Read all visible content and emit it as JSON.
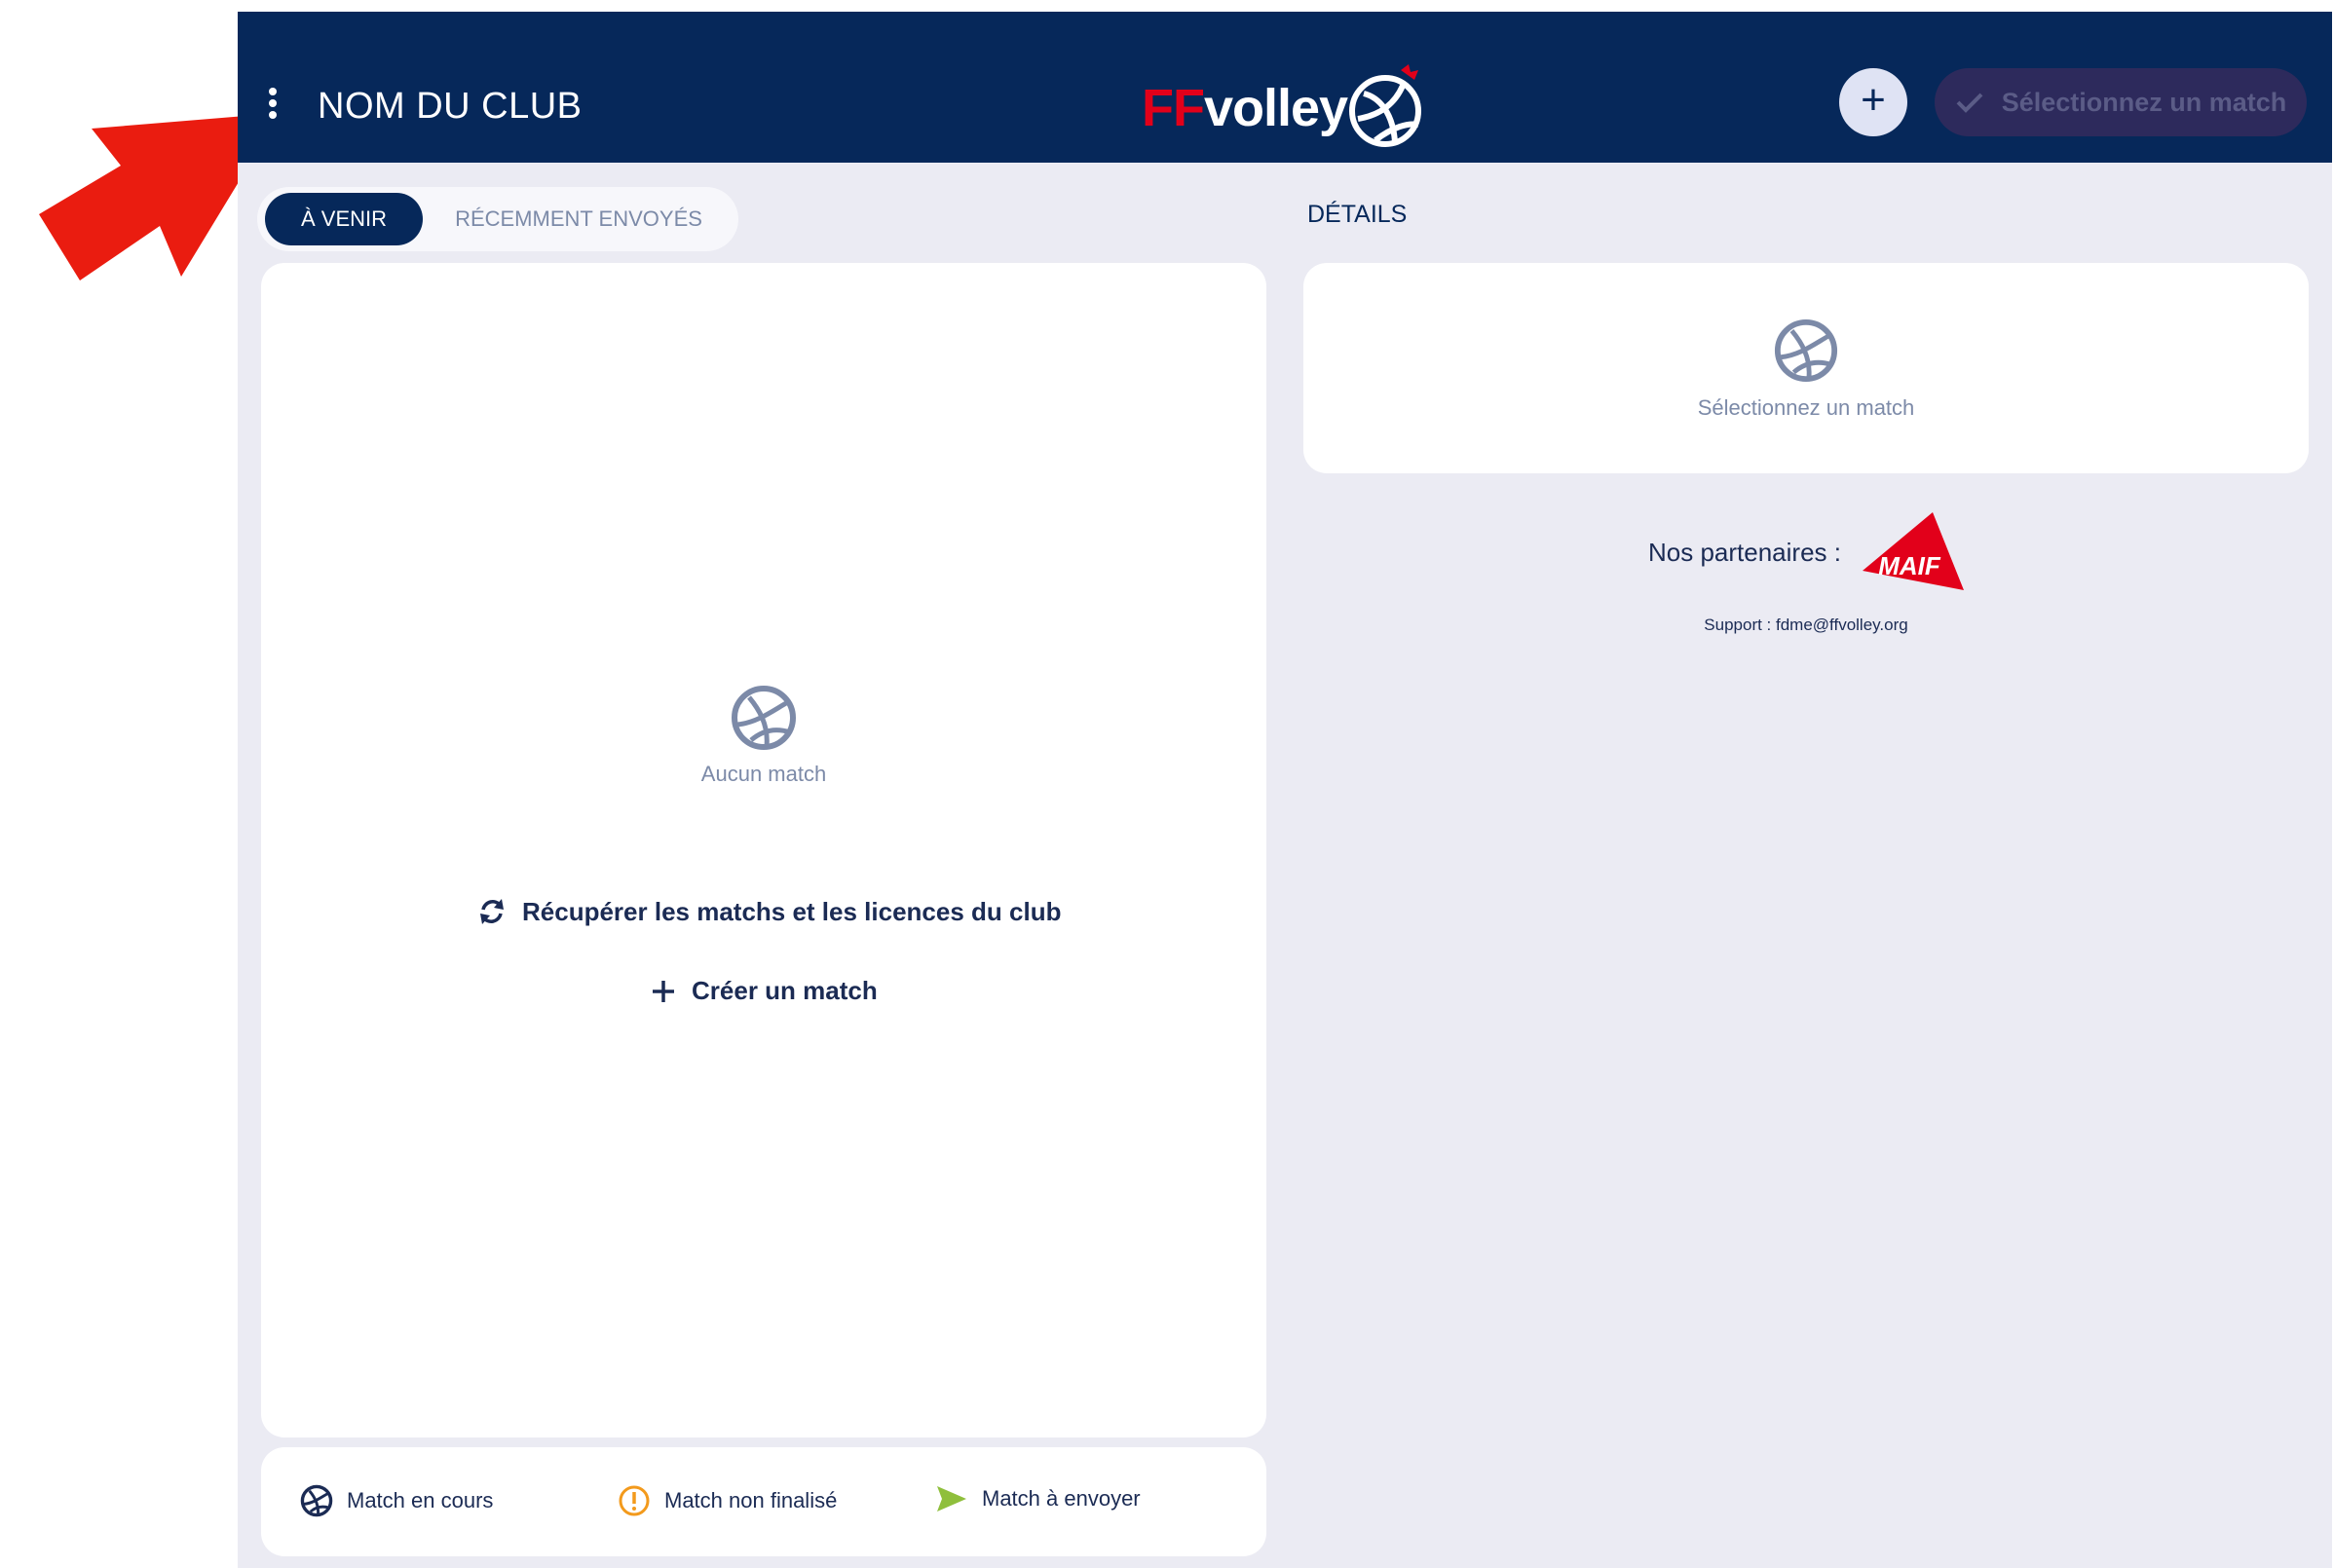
{
  "header": {
    "club_name": "NOM DU CLUB",
    "logo_ff": "FF",
    "logo_volley": "volley",
    "add_label": "+",
    "select_match_label": "Sélectionnez un match",
    "menu_icon": "vertical-dots-icon"
  },
  "tabs": [
    {
      "label": "À VENIR",
      "active": true
    },
    {
      "label": "RÉCEMMENT ENVOYÉS",
      "active": false
    }
  ],
  "details": {
    "label": "DÉTAILS",
    "empty_text": "Sélectionnez un match"
  },
  "matches": {
    "empty_text": "Aucun match",
    "fetch_label": "Récupérer les matchs et les licences du club",
    "create_label": "Créer un match"
  },
  "legend": [
    {
      "label": "Match en cours",
      "icon": "volleyball-icon"
    },
    {
      "label": "Match non finalisé",
      "icon": "warning-circle-icon"
    },
    {
      "label": "Match à envoyer",
      "icon": "send-icon"
    }
  ],
  "partners": {
    "label": "Nos partenaires :",
    "logo_text": "MAIF"
  },
  "support": {
    "text": "Support : fdme@ffvolley.org"
  },
  "colors": {
    "header_bg": "#06285a",
    "brand_red": "#e2001a",
    "page_bg": "#ebebf3",
    "muted": "#7c8aa8",
    "arrow": "#ea1c10",
    "send_green": "#8fbf3c",
    "warning_orange": "#f39a1c"
  }
}
